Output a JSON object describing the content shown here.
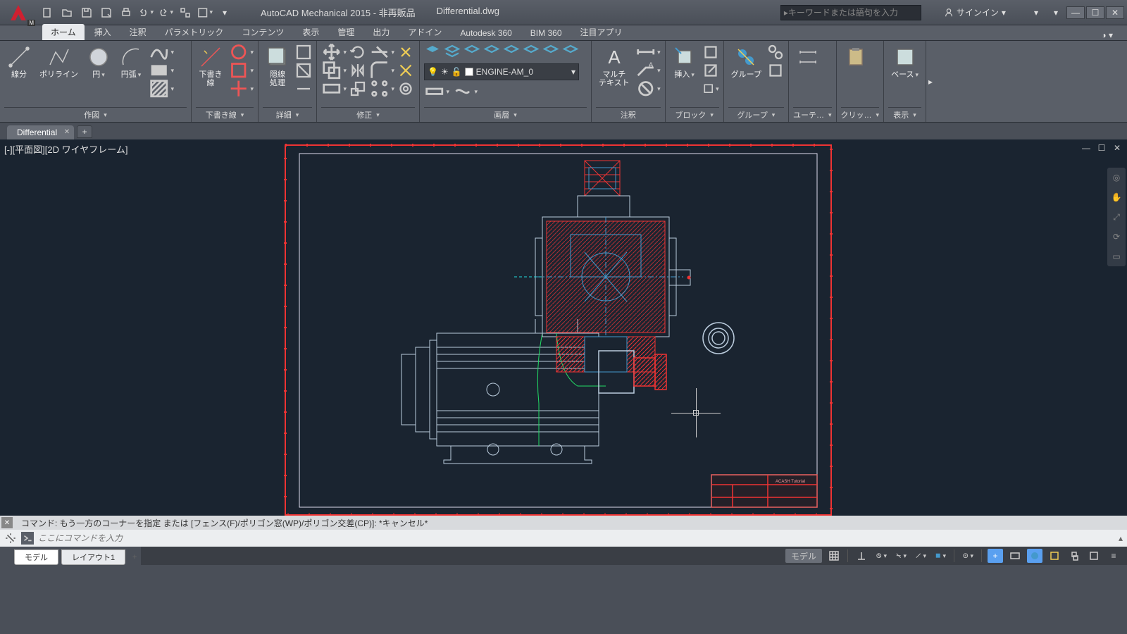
{
  "app": {
    "title": "AutoCAD Mechanical 2015 - 非再販品",
    "filename": "Differential.dwg",
    "search_placeholder": "キーワードまたは語句を入力",
    "signin": "サインイン"
  },
  "tabs": {
    "items": [
      "ホーム",
      "挿入",
      "注釈",
      "パラメトリック",
      "コンテンツ",
      "表示",
      "管理",
      "出力",
      "アドイン",
      "Autodesk 360",
      "BIM 360",
      "注目アプリ"
    ],
    "active": 0
  },
  "ribbon": {
    "draw": {
      "label": "作図",
      "line": "線分",
      "polyline": "ポリライン",
      "circle": "円",
      "arc": "円弧"
    },
    "construction": {
      "label": "下書き線",
      "btn": "下書き\n線"
    },
    "detail": {
      "label": "詳細",
      "btn": "隠線\n処理"
    },
    "modify": {
      "label": "修正"
    },
    "layers": {
      "label": "画層",
      "current": "ENGINE-AM_0"
    },
    "annotation": {
      "label": "注釈",
      "btn": "マルチ\nテキスト"
    },
    "block": {
      "label": "ブロック",
      "btn": "挿入"
    },
    "group": {
      "label": "グループ",
      "btn": "グループ"
    },
    "utilities": {
      "label": "ユーテ…"
    },
    "clipboard": {
      "label": "クリッ…"
    },
    "view": {
      "label": "表示",
      "btn": "ベース"
    }
  },
  "drawtab": {
    "name": "Differential"
  },
  "viewport": {
    "label": "[-][平面図][2D ワイヤフレーム]"
  },
  "command": {
    "history": "コマンド: もう一方のコーナーを指定 または [フェンス(F)/ポリゴン窓(WP)/ポリゴン交差(CP)]: *キャンセル*",
    "placeholder": "ここにコマンドを入力"
  },
  "layouts": {
    "model": "モデル",
    "layout1": "レイアウト1"
  },
  "status": {
    "model": "モデル"
  },
  "titleblock": {
    "line1": "ACASH Tutorial"
  }
}
